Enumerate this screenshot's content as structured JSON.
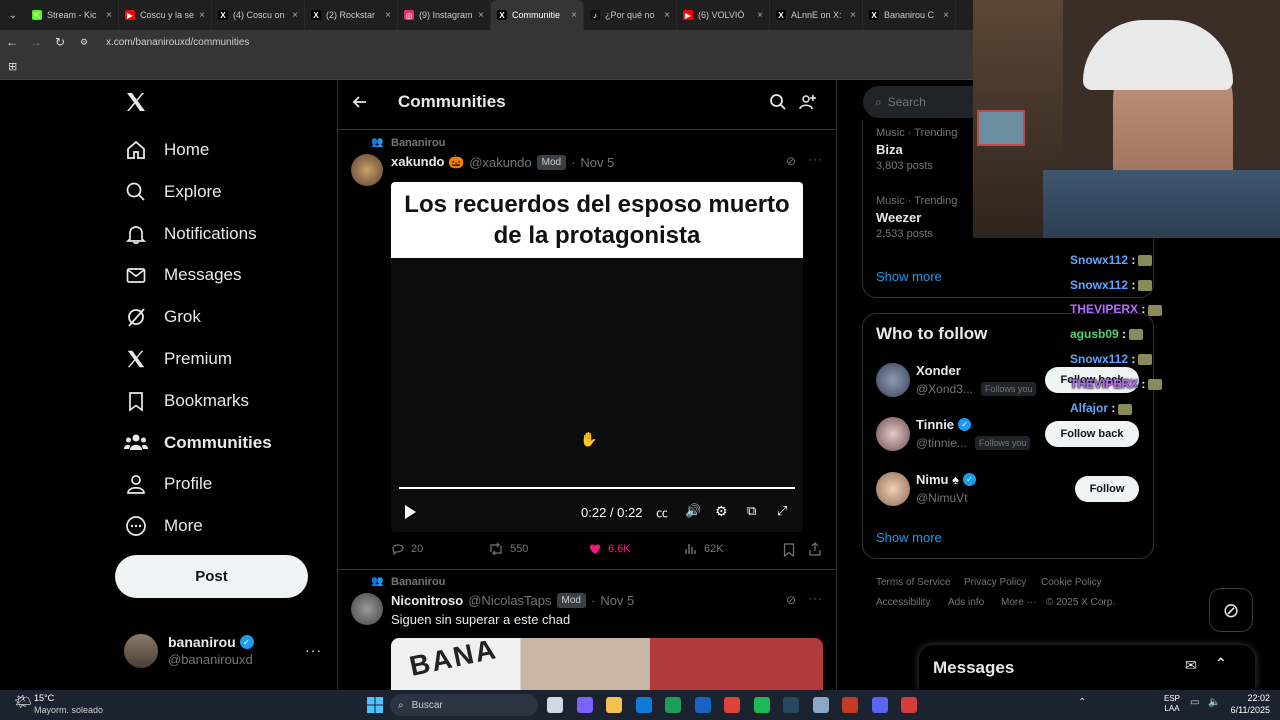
{
  "browser": {
    "tabs": [
      {
        "title": "Stream - Kic",
        "fav_color": "#53fc18",
        "fav": "K"
      },
      {
        "title": "Coscu y la se",
        "fav_color": "#ff0000",
        "fav": "▶"
      },
      {
        "title": "(4) Coscu on",
        "fav_color": "#000000",
        "fav": "X"
      },
      {
        "title": "(2) Rockstar",
        "fav_color": "#000000",
        "fav": "X"
      },
      {
        "title": "(9) Instagram",
        "fav_color": "#e1306c",
        "fav": "◎"
      },
      {
        "title": "Communitie",
        "fav_color": "#000000",
        "fav": "X",
        "active": true
      },
      {
        "title": "¿Por qué no",
        "fav_color": "#111111",
        "fav": "♪"
      },
      {
        "title": "(6) VOLVIÓ",
        "fav_color": "#ff0000",
        "fav": "▶"
      },
      {
        "title": "ALnnE on X:",
        "fav_color": "#000000",
        "fav": "X"
      },
      {
        "title": "Bananirou C",
        "fav_color": "#000000",
        "fav": "X"
      }
    ],
    "url": "x.com/bananirouxd/communities"
  },
  "nav": {
    "items": [
      {
        "label": "Home",
        "icon": "home-icon"
      },
      {
        "label": "Explore",
        "icon": "search-icon"
      },
      {
        "label": "Notifications",
        "icon": "bell-icon"
      },
      {
        "label": "Messages",
        "icon": "envelope-icon"
      },
      {
        "label": "Grok",
        "icon": "grok-icon"
      },
      {
        "label": "Premium",
        "icon": "x-logo-icon"
      },
      {
        "label": "Bookmarks",
        "icon": "bookmark-icon"
      },
      {
        "label": "Communities",
        "icon": "people-icon"
      },
      {
        "label": "Profile",
        "icon": "person-icon"
      },
      {
        "label": "More",
        "icon": "more-circle-icon"
      }
    ],
    "post_label": "Post",
    "account": {
      "name": "bananirou",
      "handle": "@bananirouxd"
    }
  },
  "main": {
    "title": "Communities",
    "posts": [
      {
        "community": "Bananirou",
        "author": "xakundo 🎃",
        "handle": "@xakundo",
        "badge": "Mod",
        "date": "Nov 5",
        "media_caption": "Los recuerdos del esposo muerto de la protagonista",
        "video_time": "0:22 / 0:22",
        "video_progress": 1.0,
        "replies": "20",
        "reposts": "550",
        "likes": "6.6K",
        "views": "62K"
      },
      {
        "community": "Bananirou",
        "author": "Niconitroso",
        "handle": "@NicolasTaps",
        "badge": "Mod",
        "date": "Nov 5",
        "text": "Siguen sin superar a este chad",
        "media_text": "BANA"
      }
    ]
  },
  "right": {
    "search_placeholder": "Search",
    "trends": [
      {
        "context": "Music · Trending",
        "name": "Biza",
        "count": "3,803 posts"
      },
      {
        "context": "Music · Trending",
        "name": "Weezer",
        "count": "2,533 posts"
      }
    ],
    "show_more": "Show more",
    "who_to_follow": {
      "title": "Who to follow",
      "users": [
        {
          "name": "Xonder",
          "handle": "@Xond3...",
          "follows_you": "Follows you",
          "button": "Follow back"
        },
        {
          "name": "Tinnie",
          "handle": "@tinnie...",
          "follows_you": "Follows you",
          "button": "Follow back"
        },
        {
          "name": "Nimu ♠",
          "handle": "@NimuVt",
          "follows_you": "",
          "button": "Follow"
        }
      ],
      "show_more": "Show more"
    },
    "footer": [
      "Terms of Service",
      "Privacy Policy",
      "Cookie Policy",
      "Accessibility",
      "Ads info",
      "More ···",
      "© 2025 X Corp."
    ],
    "messages_label": "Messages"
  },
  "chat_overlay": [
    {
      "user": "Snowx112",
      "color": "#5fa6ff"
    },
    {
      "user": "Snowx112",
      "color": "#5fa6ff"
    },
    {
      "user": "THEVIPERX",
      "color": "#b96bff"
    },
    {
      "user": "agusb09",
      "color": "#4fd46a"
    },
    {
      "user": "Snowx112",
      "color": "#5fa6ff"
    },
    {
      "user": "THEVIPERX",
      "color": "#b96bff"
    },
    {
      "user": "Alfajor",
      "color": "#5fa6ff"
    }
  ],
  "taskbar": {
    "weather_temp": "15°C",
    "weather_desc": "Mayorm. soleado",
    "search_placeholder": "Buscar",
    "lang": "ESP",
    "lang2": "LAA",
    "time": "22:02",
    "date": "6/11/2025"
  }
}
